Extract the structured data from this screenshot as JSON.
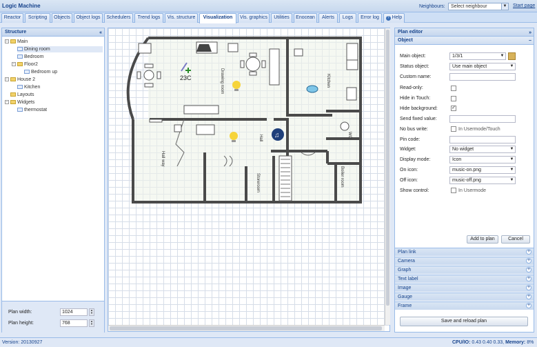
{
  "app": {
    "title": "Logic Machine"
  },
  "header": {
    "neighbours_label": "Neighbours:",
    "neighbours_value": "Select neighbour",
    "start_page": "Start page"
  },
  "tabs": [
    "Reactor",
    "Scripting",
    "Objects",
    "Object logs",
    "Schedulers",
    "Trend logs",
    "Vis. structure",
    "Visualization",
    "Vis. graphics",
    "Utilities",
    "Enocean",
    "Alerts",
    "Logs",
    "Error log",
    "Help"
  ],
  "active_tab": "Visualization",
  "structure": {
    "title": "Structure",
    "nodes": [
      {
        "label": "Main"
      },
      {
        "label": "Dining room"
      },
      {
        "label": "Bedroom"
      },
      {
        "label": "Floor2"
      },
      {
        "label": "Bedroom up"
      },
      {
        "label": "House 2"
      },
      {
        "label": "Kitchen"
      },
      {
        "label": "Layouts"
      },
      {
        "label": "Widgets"
      },
      {
        "label": "thermostat"
      }
    ],
    "plan_width_label": "Plan width:",
    "plan_width": "1024",
    "plan_height_label": "Plan height:",
    "plan_height": "768"
  },
  "floorplan": {
    "temp_label": "23C",
    "rooms": [
      "Drawing room",
      "Kitchen",
      "Hall way",
      "Hall",
      "WC",
      "Storeroom",
      "Boiler room"
    ]
  },
  "editor": {
    "title": "Plan editor",
    "section": "Object",
    "fields": {
      "main_object_label": "Main object:",
      "main_object": "1/3/1",
      "status_object_label": "Status object:",
      "status_object": "Use main object",
      "custom_name_label": "Custom name:",
      "custom_name": "",
      "read_only_label": "Read-only:",
      "hide_touch_label": "Hide in Touch:",
      "hide_bg_label": "Hide background:",
      "send_fixed_label": "Send fixed value:",
      "send_fixed": "",
      "no_bus_label": "No bus write:",
      "no_bus_text": "In Usermode/Touch",
      "pin_label": "Pin code:",
      "pin": "",
      "widget_label": "Widget:",
      "widget": "No widget",
      "display_label": "Display mode:",
      "display": "Icon",
      "on_icon_label": "On icon:",
      "on_icon": "music-on.png",
      "off_icon_label": "Off icon:",
      "off_icon": "music-off.png",
      "show_control_label": "Show control:",
      "show_control_text": "In Usermode"
    },
    "add_button": "Add to plan",
    "cancel_button": "Cancel",
    "sections": [
      "Plan link",
      "Camera",
      "Graph",
      "Text label",
      "Image",
      "Gauge",
      "Frame"
    ],
    "save_button": "Save and reload plan"
  },
  "status": {
    "version": "Version: 20130927",
    "cpu_label": "CPU/IO:",
    "cpu": "0.43 0.40 0.33,",
    "memory_label": "Memory:",
    "memory": "8%"
  }
}
